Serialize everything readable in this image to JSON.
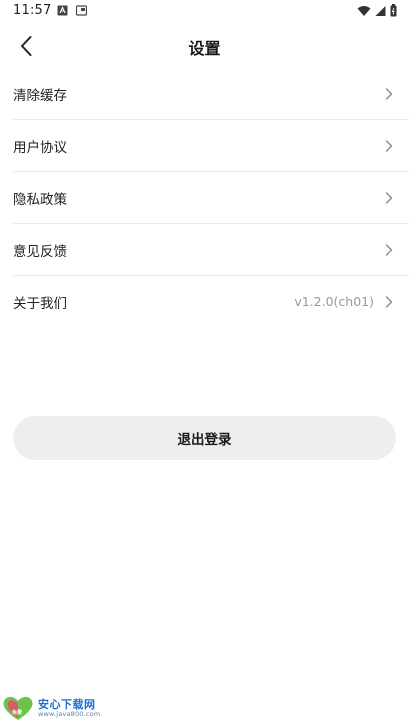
{
  "status_bar": {
    "time": "11:57"
  },
  "header": {
    "title": "设置"
  },
  "menu": {
    "items": [
      {
        "label": "清除缓存",
        "value": ""
      },
      {
        "label": "用户协议",
        "value": ""
      },
      {
        "label": "隐私政策",
        "value": ""
      },
      {
        "label": "意见反馈",
        "value": ""
      },
      {
        "label": "关于我们",
        "value": "v1.2.0(ch01)"
      }
    ]
  },
  "logout": {
    "label": "退出登录"
  },
  "watermark": {
    "brand": "安心下载网",
    "url": "www.java800.com",
    "badge": "免费"
  },
  "colors": {
    "background": "#ffffff",
    "divider": "#ececec",
    "button_bg": "#eeeeee",
    "secondary_text": "#9a9a9a"
  }
}
